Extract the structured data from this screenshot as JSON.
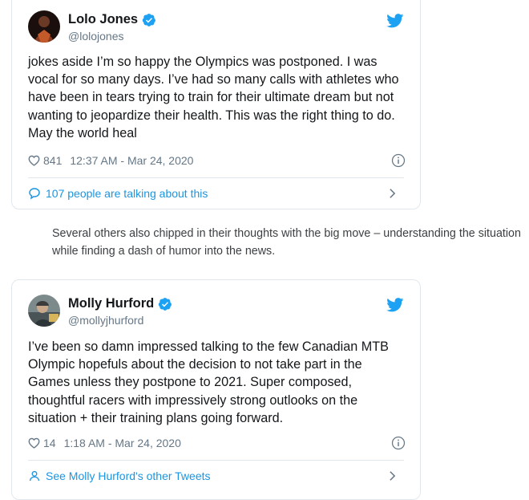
{
  "tweet1": {
    "name": "Lolo Jones",
    "handle": "@lolojones",
    "text": "jokes aside I’m so happy the Olympics was postponed. I was vocal for so many days. I’ve had so many calls with athletes who have been in tears trying to train for their ultimate dream but not wanting to jeopardize their health. This was the right thing to do. May the world heal",
    "likes": "841",
    "timestamp": "12:37 AM - Mar 24, 2020",
    "footer_link": "107 people are talking about this"
  },
  "article": {
    "paragraph": "Several others also chipped in their thoughts with the big move – understanding the situation while finding a dash of humor into the news."
  },
  "tweet2": {
    "name": "Molly Hurford",
    "handle": "@mollyjhurford",
    "text": "I’ve been so damn impressed talking to the few Canadian MTB Olympic hopefuls about the decision to not take part in the Games unless they postpone to 2021. Super composed, thoughtful racers with impressively strong outlooks on the situation + their training plans going forward.",
    "likes": "14",
    "timestamp": "1:18 AM - Mar 24, 2020",
    "footer_link": "See Molly Hurford's other Tweets"
  },
  "colors": {
    "twitter_blue": "#1da1f2",
    "link_blue": "#1b95e0",
    "secondary_text": "#657786",
    "border": "#e1e8ed"
  }
}
